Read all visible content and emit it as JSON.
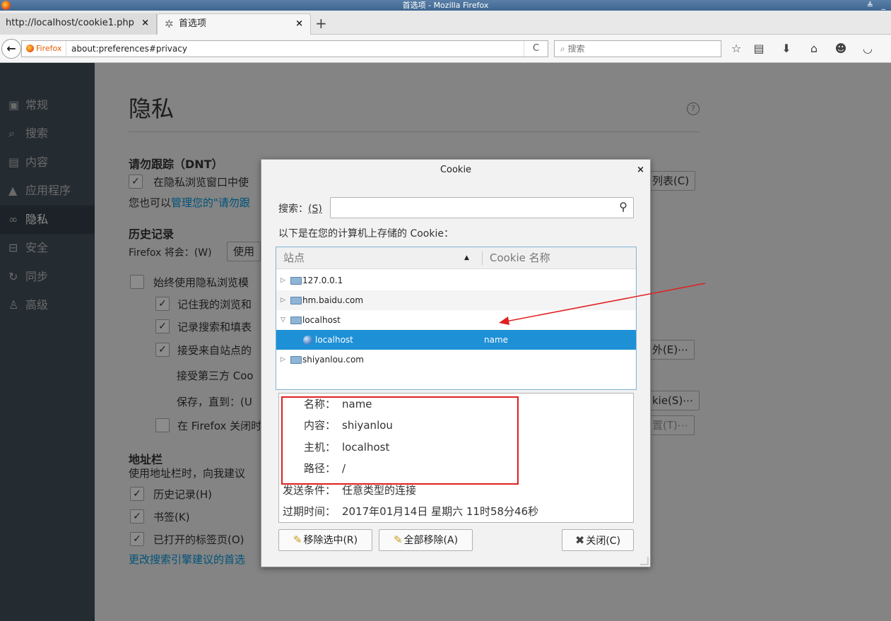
{
  "window": {
    "title": "首选项 - Mozilla Firefox",
    "controls": "≜ _"
  },
  "tabs": [
    {
      "label": "http://localhost/cookie1.php",
      "close": "×"
    },
    {
      "label": "首选项",
      "close": "×"
    }
  ],
  "newtab": "+",
  "navbar": {
    "identity": "Firefox",
    "url": "about:preferences#privacy",
    "reload": "C",
    "search_placeholder": "搜索"
  },
  "sidebar": {
    "items": [
      {
        "label": "常规",
        "icon": "general-icon"
      },
      {
        "label": "搜索",
        "icon": "search-icon"
      },
      {
        "label": "内容",
        "icon": "content-icon"
      },
      {
        "label": "应用程序",
        "icon": "applications-icon"
      },
      {
        "label": "隐私",
        "icon": "privacy-mask-icon",
        "active": true
      },
      {
        "label": "安全",
        "icon": "lock-icon"
      },
      {
        "label": "同步",
        "icon": "sync-icon"
      },
      {
        "label": "高级",
        "icon": "wizard-hat-icon"
      }
    ]
  },
  "prefs": {
    "title": "隐私",
    "help": "?",
    "dnt_heading": "请勿跟踪（DNT）",
    "dnt_checkbox": "在隐私浏览窗口中使",
    "dnt_link_prefix": "您也可以",
    "dnt_link": "管理您的\"请勿跟",
    "list_button": "列表(C)",
    "history_heading": "历史记录",
    "firefox_will": "Firefox 将会：(W)",
    "firefox_will_select": "使用",
    "always_private": "始终使用隐私浏览模",
    "remember_browsing": "记住我的浏览和",
    "remember_search": "记录搜索和填表",
    "accept_cookies": "接受来自站点的",
    "exceptions_button": "外(E)⋯",
    "accept_third_party": "接受第三方 Coo",
    "keep_until": "保存，直到：(U",
    "show_cookies_button": "kie(S)⋯",
    "clear_on_close": "在 Firefox 关闭时",
    "settings_button": "置(T)⋯",
    "addressbar_heading": "地址栏",
    "addressbar_desc": "使用地址栏时，向我建议",
    "opt_history": "历史记录(H)",
    "opt_bookmarks": "书签(K)",
    "opt_tabs": "已打开的标签页(O)",
    "change_search_link": "更改搜索引擎建议的首选"
  },
  "dialog": {
    "title": "Cookie",
    "close": "×",
    "search_label": "搜索：",
    "search_key": "(S)",
    "list_caption": "以下是在您的计算机上存储的 Cookie：",
    "col_site": "站点",
    "col_cookie_name": "Cookie 名称",
    "rows": [
      {
        "site": "127.0.0.1",
        "cookie": "",
        "twisty": "▷",
        "kind": "folder"
      },
      {
        "site": "hm.baidu.com",
        "cookie": "",
        "twisty": "▷",
        "kind": "folder"
      },
      {
        "site": "localhost",
        "cookie": "",
        "twisty": "▽",
        "kind": "folder"
      },
      {
        "site": "localhost",
        "cookie": "name",
        "twisty": "",
        "kind": "cookie",
        "selected": true
      },
      {
        "site": "shiyanlou.com",
        "cookie": "",
        "twisty": "▷",
        "kind": "folder"
      }
    ],
    "details": [
      {
        "key": "名称：",
        "value": "name"
      },
      {
        "key": "内容：",
        "value": "shiyanlou"
      },
      {
        "key": "主机：",
        "value": "localhost"
      },
      {
        "key": "路径：",
        "value": "/"
      },
      {
        "key": "发送条件：",
        "value": "任意类型的连接"
      },
      {
        "key": "过期时间：",
        "value": "2017年01月14日 星期六 11时58分46秒"
      }
    ],
    "remove_selected": "移除选中(R)",
    "remove_all": "全部移除(A)",
    "close_button": "关闭(C)"
  },
  "annotation_color": "#e02020"
}
